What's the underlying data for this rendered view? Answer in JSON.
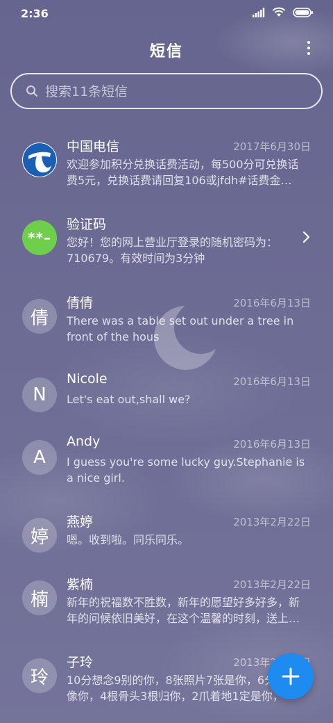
{
  "status_bar": {
    "time": "2:36"
  },
  "header": {
    "title": "短信"
  },
  "search": {
    "placeholder": "搜索11条短信"
  },
  "conversations": [
    {
      "name": "中国电信",
      "date": "2017年6月30日",
      "preview": "欢迎参加积分兑换话费活动，每500分可兑换话费5元，兑换话费请回复106或jfdh#话费金…",
      "avatar_type": "telecom-logo",
      "avatar_color": "#1a5fb4"
    },
    {
      "name": "验证码",
      "date": "",
      "preview": "您好！您的网上营业厅登录的随机密码为：710679。有效时间为3分钟",
      "avatar_text": "**–",
      "avatar_color": "#6fcf4c"
    },
    {
      "name": "倩倩",
      "date": "2016年6月13日",
      "preview": "There was a table set out under a tree in front of the hous",
      "avatar_text": "倩"
    },
    {
      "name": "Nicole",
      "date": "2016年6月13日",
      "preview": "Let's eat out,shall we?",
      "avatar_text": "N"
    },
    {
      "name": "Andy",
      "date": "2016年6月13日",
      "preview": "I guess you're some lucky guy.Stephanie is a nice girl.",
      "avatar_text": "A"
    },
    {
      "name": "燕婷",
      "date": "2013年2月22日",
      "preview": "嗯。收到啦。同乐同乐。",
      "avatar_text": "婷"
    },
    {
      "name": "紫楠",
      "date": "2013年2月22日",
      "preview": "新年的祝福数不胜数，新年的愿望好多好多，新年的问候依旧美好，在这个温馨的时刻，送上…",
      "avatar_text": "楠"
    },
    {
      "name": "子玲",
      "date": "2013年2月22日",
      "preview": "10分想念9别的你，8张照片7张是你，6分不…只像你，4根骨头3根归你，2爪着地1定是你，",
      "avatar_text": "玲"
    }
  ],
  "colors": {
    "fab": "#1d8bf0",
    "background": "#6c6b94"
  },
  "icons": {
    "fab": "plus-icon",
    "menu": "more-vertical-icon",
    "search": "search-icon",
    "row_action": "chevron-right-icon"
  }
}
